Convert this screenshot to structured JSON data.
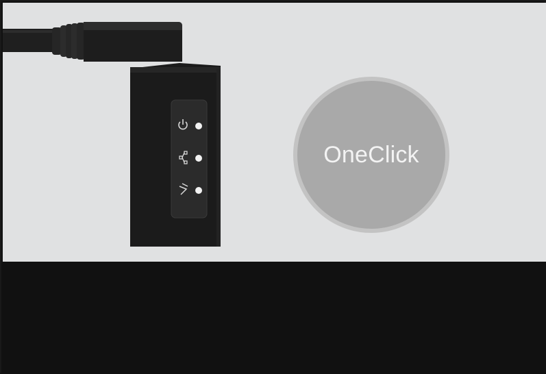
{
  "oneclick_button": {
    "label": "OneClick"
  },
  "device": {
    "led_indicators": [
      {
        "icon": "power-icon"
      },
      {
        "icon": "network-icon"
      },
      {
        "icon": "bluetooth-icon"
      }
    ]
  },
  "colors": {
    "scene_background": "#e0e1e2",
    "page_background": "#111111",
    "button_fill": "#a9a9a9",
    "button_ring": "#c3c3c3",
    "button_text": "#f3f3f3",
    "device_body": "#1b1b1b"
  }
}
